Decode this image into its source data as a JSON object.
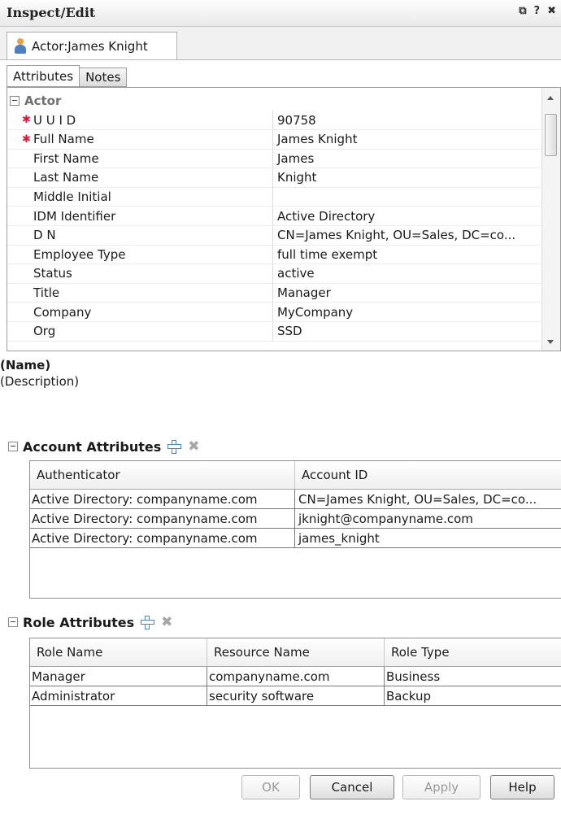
{
  "window": {
    "title": "Inspect/Edit",
    "controls": [
      "⧉",
      "?",
      "✖"
    ]
  },
  "doc_tab": {
    "label": "Actor:James Knight",
    "icon": "person-icon"
  },
  "subtabs": [
    "Attributes",
    "Notes"
  ],
  "actor_group": {
    "label": "Actor",
    "rows": [
      {
        "name": "U U I D",
        "value": "90758",
        "required": true
      },
      {
        "name": "Full Name",
        "value": "James Knight",
        "required": true
      },
      {
        "name": "First Name",
        "value": "James",
        "required": false
      },
      {
        "name": "Last Name",
        "value": "Knight",
        "required": false
      },
      {
        "name": "Middle Initial",
        "value": "",
        "required": false
      },
      {
        "name": "IDM Identifier",
        "value": "Active Directory",
        "required": false
      },
      {
        "name": "D N",
        "value": "CN=James Knight, OU=Sales, DC=co...",
        "required": false
      },
      {
        "name": "Employee Type",
        "value": "full time exempt",
        "required": false
      },
      {
        "name": "Status",
        "value": "active",
        "required": false
      },
      {
        "name": "Title",
        "value": "Manager",
        "required": false
      },
      {
        "name": "Company",
        "value": "MyCompany",
        "required": false
      },
      {
        "name": "Org",
        "value": "SSD",
        "required": false
      }
    ]
  },
  "description": {
    "name": "(Name)",
    "text": "(Description)"
  },
  "account_attributes": {
    "label": "Account Attributes",
    "columns": [
      "Authenticator",
      "Account ID"
    ],
    "rows": [
      [
        "Active Directory: companyname.com",
        "CN=James Knight, OU=Sales, DC=co..."
      ],
      [
        "Active Directory: companyname.com",
        "jknight@companyname.com"
      ],
      [
        "Active Directory: companyname.com",
        "james_knight"
      ]
    ]
  },
  "role_attributes": {
    "label": "Role Attributes",
    "columns": [
      "Role Name",
      "Resource Name",
      "Role Type"
    ],
    "rows": [
      [
        "Manager",
        "companyname.com",
        "Business"
      ],
      [
        "Administrator",
        "security software",
        "Backup"
      ]
    ]
  },
  "buttons": {
    "ok": "OK",
    "cancel": "Cancel",
    "apply": "Apply",
    "help": "Help"
  },
  "colors": {
    "required_marker": "#c8233b",
    "add_icon": "#4f86b5"
  }
}
